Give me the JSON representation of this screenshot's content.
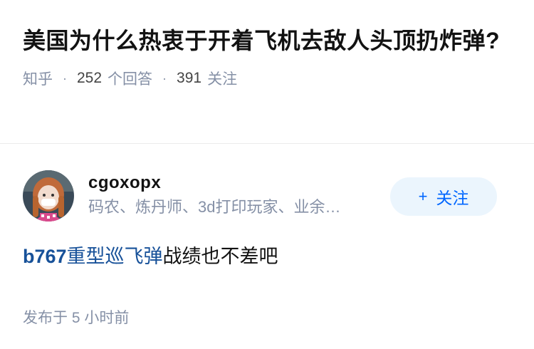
{
  "question": {
    "title": "美国为什么热衷于开着飞机去敌人头顶扔炸弹?",
    "source": "知乎",
    "answer_count": "252",
    "answer_label": "个回答",
    "follow_count": "391",
    "follow_label": "关注"
  },
  "answer": {
    "author_name": "cgoxopx",
    "author_bio": "码农、炼丹师、3d打印玩家、业余…",
    "follow_button": "关注",
    "follow_plus": "+",
    "content_link1": "b767",
    "content_link2": "重型巡飞弹",
    "content_rest": "战绩也不差吧",
    "published": "发布于 5 小时前"
  },
  "colors": {
    "link": "#175199",
    "follow_text": "#0066ff",
    "follow_bg": "#ebf5fd",
    "meta": "#8590a6"
  },
  "icons": {
    "avatar": "avatar-girl-pink-hair"
  }
}
